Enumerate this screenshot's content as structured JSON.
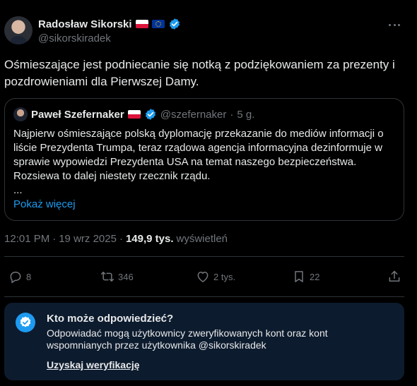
{
  "post": {
    "author_name": "Radosław Sikorski",
    "author_handle": "@sikorskiradek",
    "text": "Ośmieszające jest podniecanie się notką z podziękowaniem za prezenty i pozdrowieniami dla Pierwszej Damy.",
    "time": "12:01 PM",
    "separator": "·",
    "date": "19 wrz 2025",
    "views_count": "149,9 tys.",
    "views_label": "wyświetleń"
  },
  "quote": {
    "author_name": "Paweł Szefernaker",
    "author_handle": "@szefernaker",
    "age": "5 g.",
    "text": "Najpierw ośmieszające polską dyplomację przekazanie do mediów informacji o liście Prezydenta Trumpa, teraz rządowa agencja informacyjna dezinformuje w sprawie wypowiedzi Prezydenta USA na temat naszego bezpieczeństwa. Rozsiewa to dalej niestety rzecznik rządu.",
    "ellipsis": "...",
    "show_more": "Pokaż więcej"
  },
  "actions": {
    "replies": "8",
    "reposts": "346",
    "likes": "2 tys.",
    "bookmarks": "22"
  },
  "reply_restriction": {
    "title": "Kto może odpowiedzieć?",
    "description": "Odpowiadać mogą użytkownicy zweryfikowanych kont oraz kont wspomnianych przez użytkownika @sikorskiradek",
    "link": "Uzyskaj weryfikację"
  },
  "colors": {
    "background": "#000000",
    "text": "#e7e9ea",
    "secondary": "#71767b",
    "accent": "#1d9bf0",
    "border": "#2f3336",
    "reply_box": "#0d1b2e"
  },
  "icons": [
    "more-icon",
    "verified-badge-icon",
    "poland-flag-icon",
    "eu-flag-icon",
    "reply-icon",
    "repost-icon",
    "like-icon",
    "bookmark-icon",
    "share-icon",
    "checkmark-badge-icon"
  ]
}
